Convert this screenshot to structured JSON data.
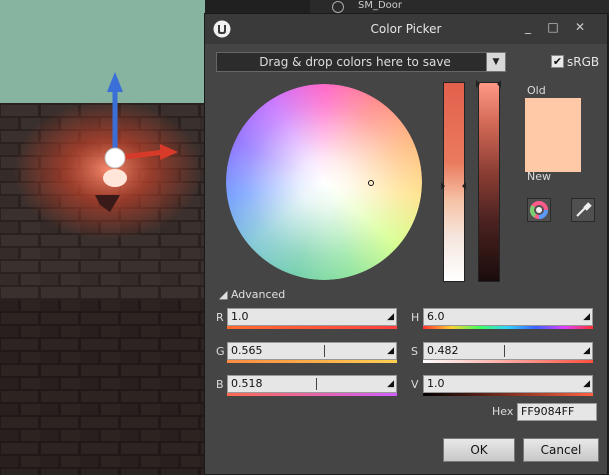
{
  "outliner": {
    "item_label": "SM_Door"
  },
  "window": {
    "title": "Color Picker",
    "minimize_glyph": "_",
    "maximize_glyph": "□",
    "close_glyph": "✕"
  },
  "swatch_bar": {
    "label": "Drag & drop colors here to save",
    "dropdown_glyph": "▼"
  },
  "srgb": {
    "checked": true,
    "label": "sRGB",
    "check_glyph": "✔"
  },
  "preview": {
    "old_label": "Old",
    "new_label": "New",
    "old_color": "#ffc9a8",
    "new_color": "#ffc9a8"
  },
  "advanced": {
    "label": "◢ Advanced"
  },
  "channels": {
    "r": {
      "label": "R",
      "value": "1.0"
    },
    "g": {
      "label": "G",
      "value": "0.565"
    },
    "b": {
      "label": "B",
      "value": "0.518"
    },
    "h": {
      "label": "H",
      "value": "6.0"
    },
    "s": {
      "label": "S",
      "value": "0.482"
    },
    "v": {
      "label": "V",
      "value": "1.0"
    }
  },
  "hex": {
    "label": "Hex",
    "value": "FF9084FF"
  },
  "buttons": {
    "ok": "OK",
    "cancel": "Cancel"
  },
  "icons": {
    "logo": "unreal-logo-icon",
    "wheel_mode": "color-wheel-icon",
    "eyedropper": "eyedropper-icon"
  },
  "colors": {
    "dialog_bg": "#454545",
    "titlebar": "#3a3a3a",
    "current_color": "#ff9084"
  }
}
